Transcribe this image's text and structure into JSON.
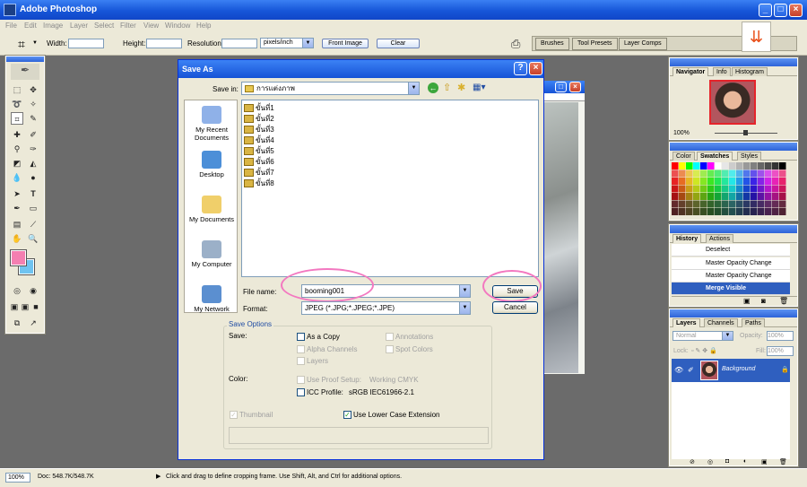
{
  "app": {
    "title": "Adobe Photoshop"
  },
  "menu": [
    "File",
    "Edit",
    "Image",
    "Layer",
    "Select",
    "Filter",
    "View",
    "Window",
    "Help"
  ],
  "options": {
    "width_label": "Width:",
    "height_label": "Height:",
    "resolution_label": "Resolution:",
    "units": "pixels/inch",
    "front_image": "Front Image",
    "clear": "Clear",
    "well_tabs": [
      "Brushes",
      "Tool Presets",
      "Layer Comps"
    ]
  },
  "dialog": {
    "title": "Save As",
    "save_in_label": "Save in:",
    "save_in_value": "การแต่งภาพ",
    "places": [
      "My Recent Documents",
      "Desktop",
      "My Documents",
      "My Computer",
      "My Network"
    ],
    "files": [
      "ขั้นที่1",
      "ขั้นที่2",
      "ขั้นที่3",
      "ขั้นที่4",
      "ขั้นที่5",
      "ขั้นที่6",
      "ขั้นที่7",
      "ขั้นที่8"
    ],
    "file_name_label": "File name:",
    "file_name_value": "booming001",
    "format_label": "Format:",
    "format_value": "JPEG (*.JPG;*.JPEG;*.JPE)",
    "save_button": "Save",
    "cancel_button": "Cancel",
    "save_options_label": "Save Options",
    "save_label": "Save:",
    "as_a_copy": "As a Copy",
    "annotations": "Annotations",
    "alpha_channels": "Alpha Channels",
    "spot_colors": "Spot Colors",
    "layers": "Layers",
    "color_label": "Color:",
    "use_proof_setup": "Use Proof Setup:",
    "working_cmyk": "Working CMYK",
    "icc_profile": "ICC Profile:",
    "icc_value": "sRGB IEC61966-2.1",
    "thumbnail": "Thumbnail",
    "use_lower_case": "Use Lower Case Extension"
  },
  "navigator": {
    "tabs": [
      "Navigator",
      "Info",
      "Histogram"
    ],
    "zoom": "100%"
  },
  "swatches": {
    "tabs": [
      "Color",
      "Swatches",
      "Styles"
    ]
  },
  "history": {
    "tabs": [
      "History",
      "Actions"
    ],
    "items": [
      "Deselect",
      "Master Opacity Change",
      "Master Opacity Change",
      "Merge Visible"
    ],
    "selected_index": 3
  },
  "layers": {
    "tabs": [
      "Layers",
      "Channels",
      "Paths"
    ],
    "blend_mode": "Normal",
    "opacity_label": "Opacity:",
    "opacity_value": "100%",
    "lock_label": "Lock:",
    "fill_label": "Fill:",
    "fill_value": "100%",
    "layer_name": "Background"
  },
  "status": {
    "zoom": "100%",
    "doc": "Doc: 548.7K/548.7K",
    "hint": "Click and drag to define cropping frame. Use Shift, Alt, and Ctrl for additional options."
  },
  "colors": {
    "foreground": "#f47fb1",
    "background": "#6fc3f0",
    "accent": "#f378c0"
  }
}
